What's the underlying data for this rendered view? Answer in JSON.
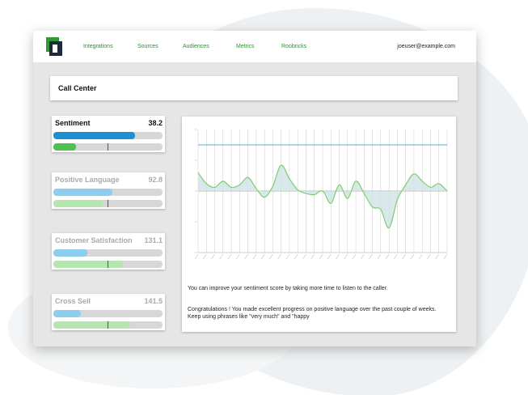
{
  "nav": {
    "items": [
      "Integrations",
      "Sources",
      "Audiences",
      "Metrics",
      "Roobricks"
    ],
    "user": "joeuser@example.com"
  },
  "page": {
    "title": "Call Center"
  },
  "metrics": [
    {
      "name": "Sentiment",
      "value": "38.2",
      "bar_primary": 0.75,
      "bar_secondary": 0.21,
      "active": true
    },
    {
      "name": "Positive Language",
      "value": "92.8",
      "bar_primary": 0.54,
      "bar_secondary": 0.45,
      "active": false
    },
    {
      "name": "Customer Satisfaction",
      "value": "131.1",
      "bar_primary": 0.31,
      "bar_secondary": 0.64,
      "active": false
    },
    {
      "name": "Cross Sell",
      "value": "141.5",
      "bar_primary": 0.25,
      "bar_secondary": 0.7,
      "active": false
    }
  ],
  "insights": {
    "line1": "You can improve your sentiment score by taking more time to listen to the caller.",
    "line2": "Congratulations ! You made excellent progress on positive language over the past couple of weeks. Keep using phrases like \"very much\" and \"happy"
  },
  "colors": {
    "accent_green": "#2f8f2f",
    "bar_blue": "#1f8fd3",
    "bar_green": "#4fc14f",
    "line_green": "#7ccf6e",
    "reference_line": "#5aa9d6"
  },
  "chart_data": {
    "type": "area",
    "reference_line": 0.75,
    "ylim": [
      -1,
      1
    ],
    "grid": true,
    "x_count": 30,
    "values": [
      0.3,
      0.12,
      0.06,
      0.16,
      0.06,
      0.1,
      0.22,
      0.04,
      -0.1,
      0.08,
      0.42,
      0.2,
      0.02,
      -0.04,
      -0.06,
      0.0,
      -0.2,
      0.1,
      -0.12,
      0.16,
      -0.04,
      -0.26,
      -0.3,
      -0.6,
      -0.14,
      0.1,
      0.28,
      0.16,
      0.06,
      0.12,
      0.0
    ]
  }
}
